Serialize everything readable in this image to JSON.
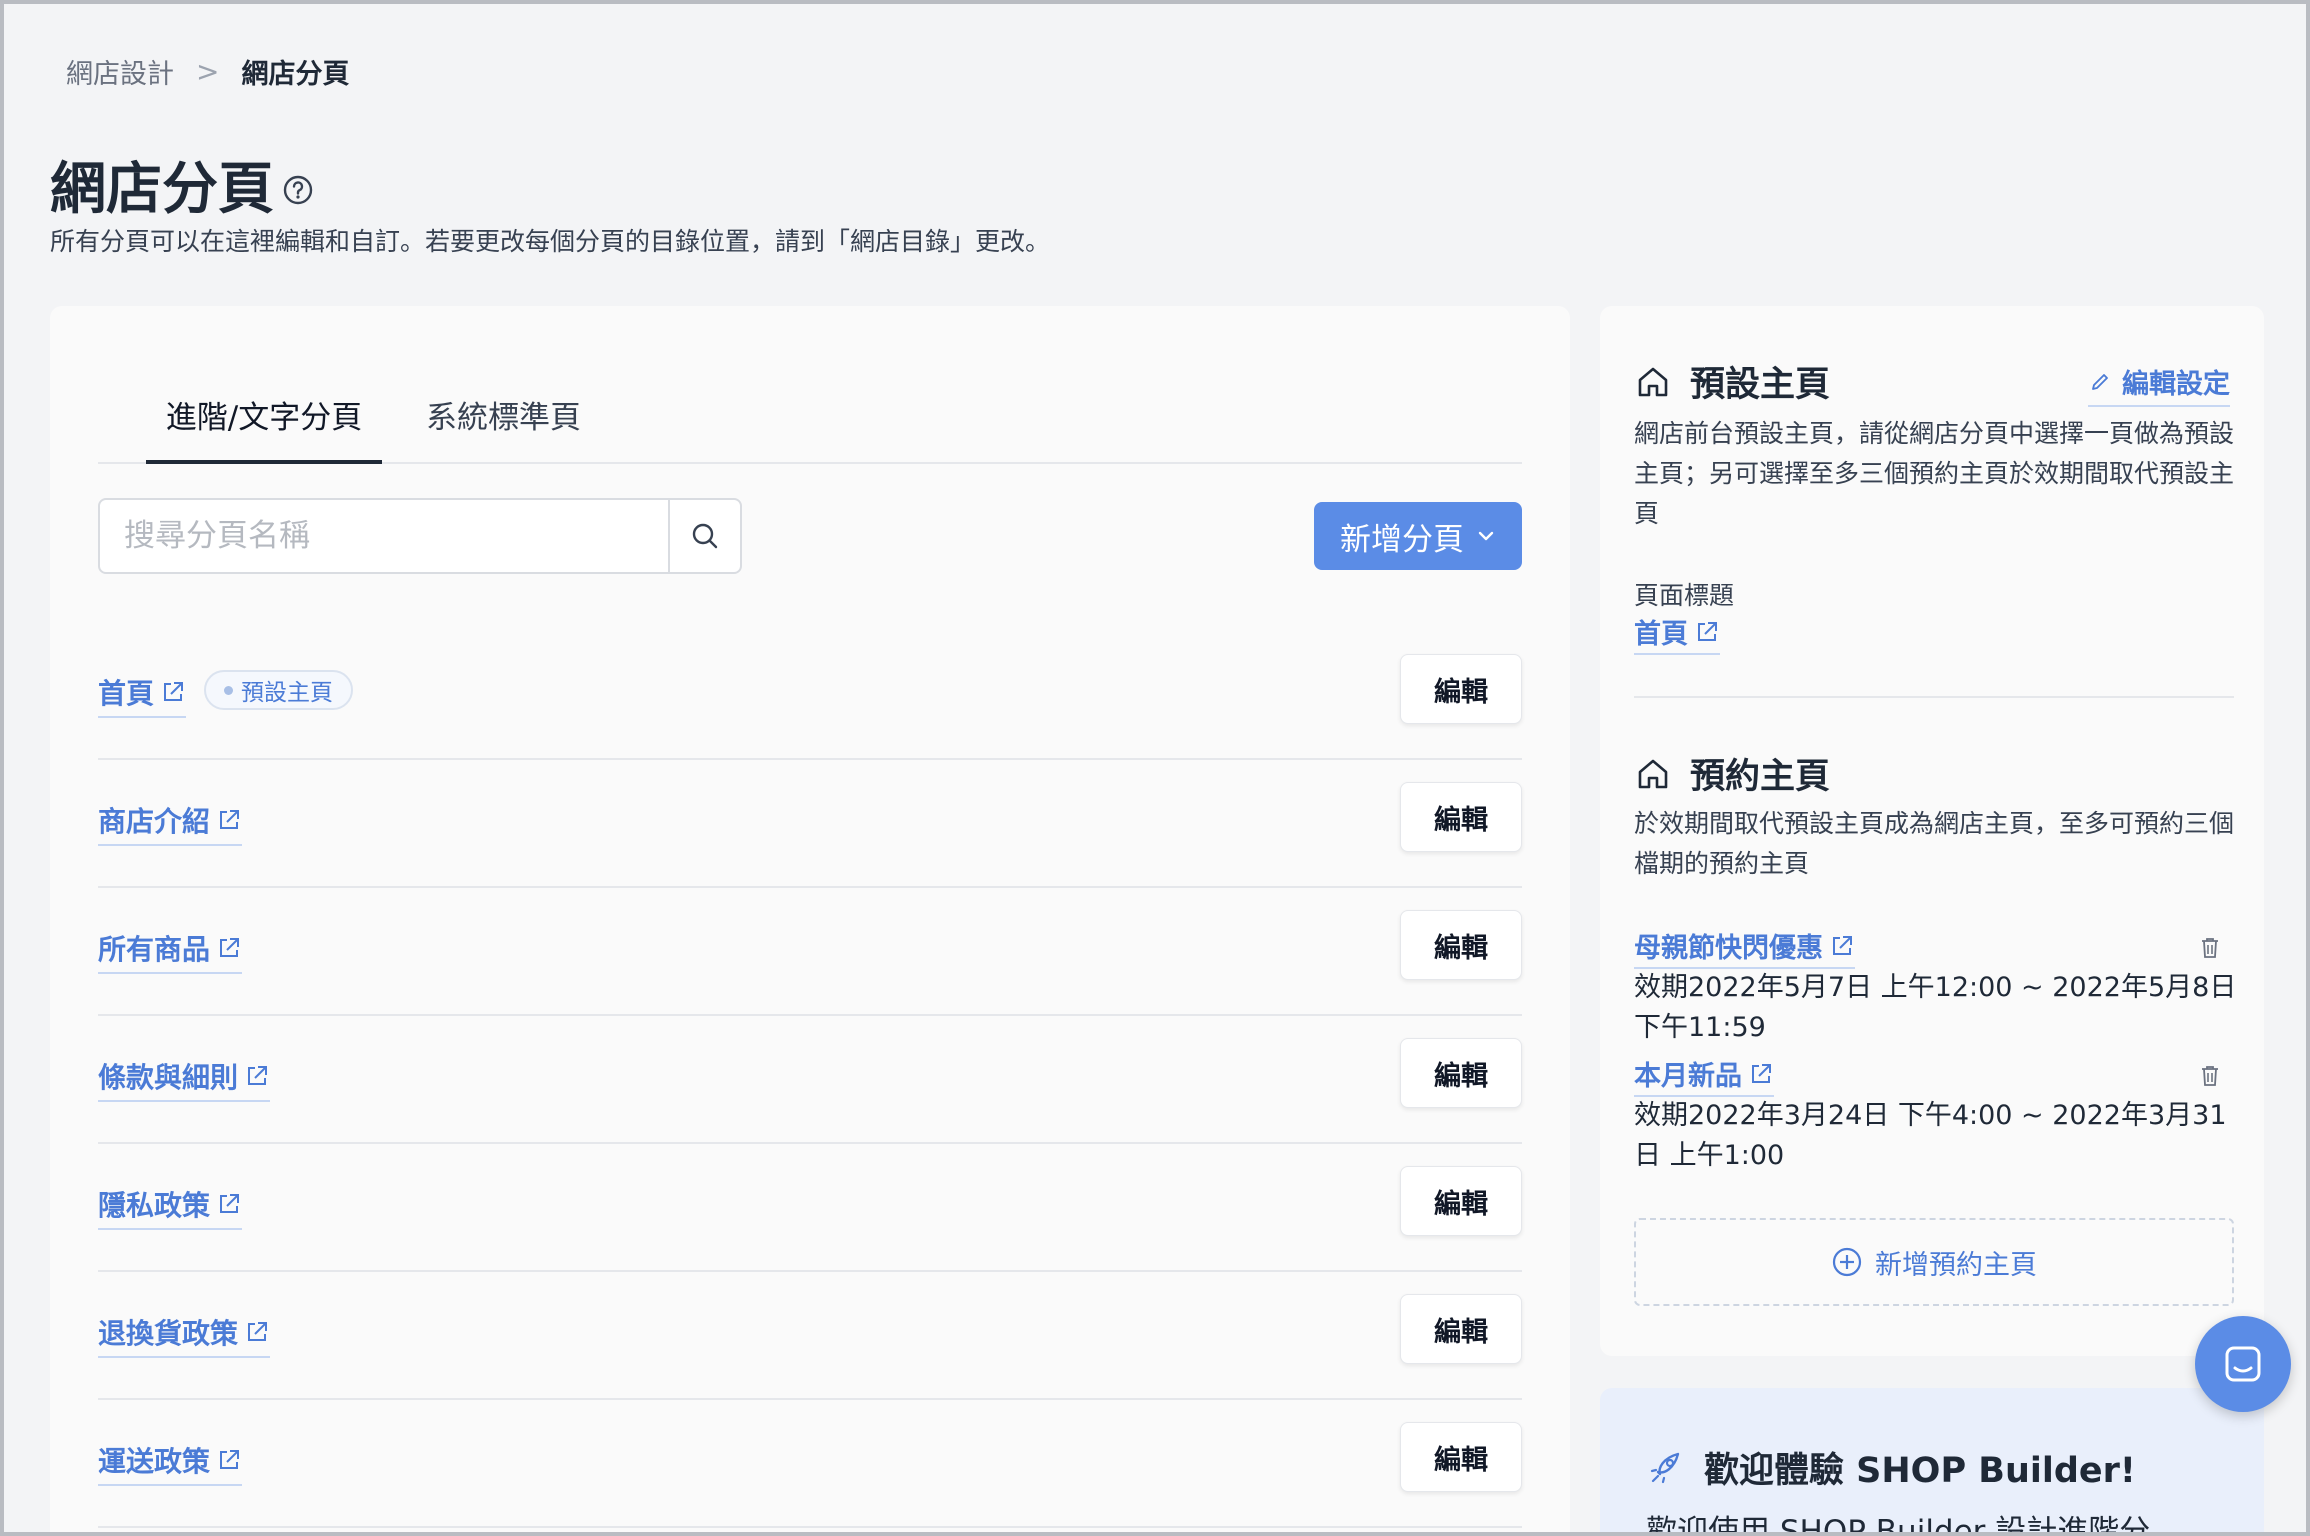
{
  "breadcrumb": {
    "parent": "網店設計",
    "separator": ">",
    "current": "網店分頁"
  },
  "page": {
    "title": "網店分頁",
    "description": "所有分頁可以在這裡編輯和自訂。若要更改每個分頁的目錄位置，請到「網店目錄」更改。"
  },
  "tabs": [
    {
      "label": "進階/文字分頁",
      "active": true
    },
    {
      "label": "系統標準頁",
      "active": false
    }
  ],
  "search": {
    "placeholder": "搜尋分頁名稱"
  },
  "add_page_button": {
    "label": "新增分頁"
  },
  "pages": [
    {
      "name": "首頁",
      "badge": "預設主頁",
      "edit_label": "編輯"
    },
    {
      "name": "商店介紹",
      "edit_label": "編輯"
    },
    {
      "name": "所有商品",
      "edit_label": "編輯"
    },
    {
      "name": "條款與細則",
      "edit_label": "編輯"
    },
    {
      "name": "隱私政策",
      "edit_label": "編輯"
    },
    {
      "name": "退換貨政策",
      "edit_label": "編輯"
    },
    {
      "name": "運送政策",
      "edit_label": "編輯"
    }
  ],
  "default_home": {
    "title": "預設主頁",
    "edit_settings": "編輯設定",
    "description": "網店前台預設主頁，請從網店分頁中選擇一頁做為預設主頁；另可選擇至多三個預約主頁於效期間取代預設主頁",
    "page_title_label": "頁面標題",
    "page_title_value": "首頁"
  },
  "scheduled_home": {
    "title": "預約主頁",
    "description": "於效期間取代預設主頁成為網店主頁，至多可預約三個檔期的預約主頁",
    "items": [
      {
        "name": "母親節快閃優惠",
        "period": "效期2022年5月7日 上午12:00 ~ 2022年5月8日 下午11:59"
      },
      {
        "name": "本月新品",
        "period": "效期2022年3月24日 下午4:00 ~ 2022年3月31日 上午1:00"
      }
    ],
    "add_label": "新增預約主頁"
  },
  "welcome": {
    "title": "歡迎體驗 SHOP Builder!",
    "text": "歡迎使用 SHOP Builder 設計進階分"
  },
  "colors": {
    "accent": "#5b8ce6",
    "link": "#4b7bd6"
  }
}
